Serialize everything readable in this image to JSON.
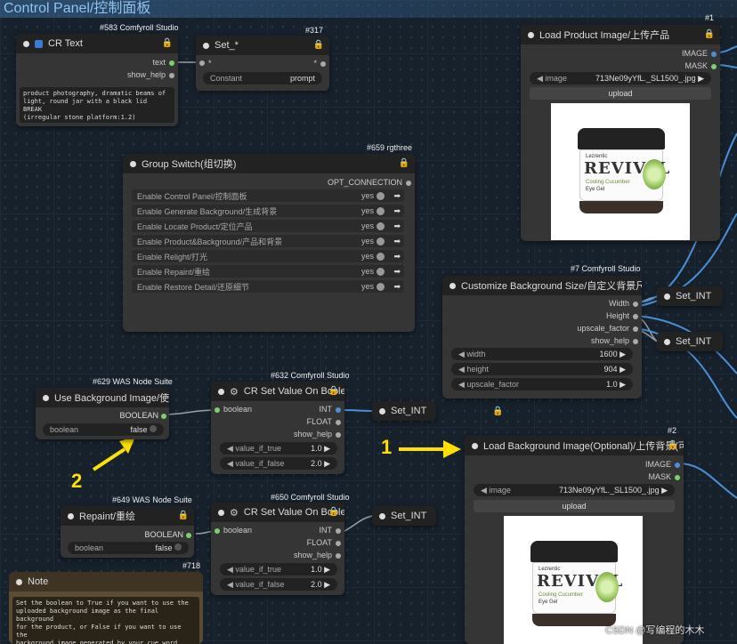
{
  "group": {
    "title": "Control Panel/控制面板"
  },
  "nodes": {
    "cr_text": {
      "badge": "#583 Comfyroll Studio",
      "title": "CR Text",
      "out_text": "text",
      "out_help": "show_help",
      "content": "product photography, dramatic beams of\nlight, round jar with a black lid\nBREAK\n(irregular stone platform:1.2)"
    },
    "set_star": {
      "badge": "#317",
      "title": "Set_*",
      "in_star": "*",
      "out_star": "*",
      "widget_label": "Constant",
      "widget_value": "prompt"
    },
    "load_product": {
      "badge": "#1",
      "title": "Load Product Image/上传产品",
      "out_image": "IMAGE",
      "out_mask": "MASK",
      "image_label": "image",
      "image_value": "713Ne09yYfL._SL1500_.jpg",
      "upload": "upload"
    },
    "group_switch": {
      "badge": "#659 rgthree",
      "title": "Group Switch(组切换)",
      "out_opt": "OPT_CONNECTION",
      "toggles": [
        {
          "label": "Enable Control Panel/控制面板",
          "value": "yes"
        },
        {
          "label": "Enable Generate Background/生成背景",
          "value": "yes"
        },
        {
          "label": "Enable Locate Product/定位产品",
          "value": "yes"
        },
        {
          "label": "Enable Product&Background/产品和背景",
          "value": "yes"
        },
        {
          "label": "Enable Relight/打光",
          "value": "yes"
        },
        {
          "label": "Enable Repaint/重绘",
          "value": "yes"
        },
        {
          "label": "Enable Restore Detail/还原细节",
          "value": "yes"
        }
      ]
    },
    "custom_bg": {
      "badge": "#7 Comfyroll Studio",
      "title": "Customize Background Size/自定义背景尺寸",
      "out_width": "Width",
      "out_height": "Height",
      "out_upscale": "upscale_factor",
      "out_help": "show_help",
      "widgets": [
        {
          "label": "width",
          "value": "1600"
        },
        {
          "label": "height",
          "value": "904"
        },
        {
          "label": "upscale_factor",
          "value": "1.0"
        }
      ]
    },
    "set_int_a": {
      "title": "Set_INT"
    },
    "set_int_b": {
      "title": "Set_INT"
    },
    "set_int_c": {
      "title": "Set_INT"
    },
    "set_int_d": {
      "title": "Set_INT"
    },
    "use_bg": {
      "badge": "#629 WAS Node Suite",
      "title": "Use Background Image/使用背景图",
      "out_bool": "BOOLEAN",
      "widget_label": "boolean",
      "widget_value": "false"
    },
    "cr_set_632": {
      "badge": "#632 Comfyroll Studio",
      "title": "CR Set Value On Boolean",
      "in_bool": "boolean",
      "out_int": "INT",
      "out_float": "FLOAT",
      "out_help": "show_help",
      "w1_label": "value_if_true",
      "w1_value": "1.0",
      "w2_label": "value_if_false",
      "w2_value": "2.0"
    },
    "load_bg": {
      "badge": "#2",
      "title": "Load Background Image(Optional)/上传背景(可选)",
      "out_image": "IMAGE",
      "out_mask": "MASK",
      "image_label": "image",
      "image_value": "713Ne09yYfL._SL1500_.jpg",
      "upload": "upload"
    },
    "repaint": {
      "badge": "#649 WAS Node Suite",
      "title": "Repaint/重绘",
      "out_bool": "BOOLEAN",
      "widget_label": "boolean",
      "widget_value": "false"
    },
    "cr_set_650": {
      "badge": "#650 Comfyroll Studio",
      "title": "CR Set Value On Boolean",
      "in_bool": "boolean",
      "out_int": "INT",
      "out_float": "FLOAT",
      "out_help": "show_help",
      "w1_label": "value_if_true",
      "w1_value": "1.0",
      "w2_label": "value_if_false",
      "w2_value": "2.0"
    },
    "note": {
      "badge": "#718",
      "title": "Note",
      "content": "Set the boolean to True if you want to use the\nuploaded background image as the final background\nfor the product, or False if you want to use the\nbackground image generated by your cue word. Set\nthe boolean to True if you want to repaint the\nimage that was re-lightened, otherwise set it to"
    }
  },
  "product_label": {
    "brand": "REVIVAL",
    "maker": "Lezrentic",
    "line1": "Cooling Cucumber",
    "line2": "Eye Gel"
  },
  "annotations": {
    "arrow1": "1",
    "arrow2": "2"
  },
  "watermark": "CSDN @写编程的木木",
  "colors": {
    "link_blue": "#4a90d9",
    "link_gray": "#9aa0a6",
    "annotation_yellow": "#ffe000",
    "lock": "#d4a64a"
  }
}
